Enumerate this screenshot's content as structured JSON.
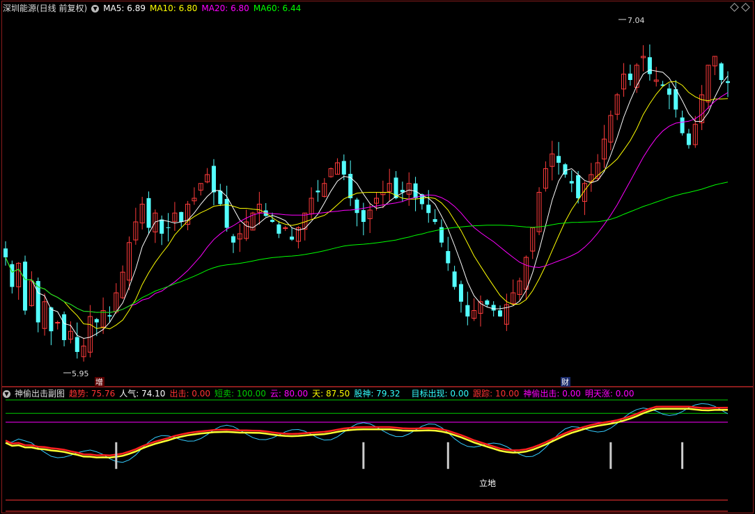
{
  "main": {
    "title": "深圳能源(日线 前复权)",
    "ma_labels": [
      {
        "text": "MA5: 6.89",
        "color": "#ffffff"
      },
      {
        "text": "MA10: 6.80",
        "color": "#ffff00"
      },
      {
        "text": "MA20: 6.80",
        "color": "#ff00ff"
      },
      {
        "text": "MA60: 6.44",
        "color": "#00ff00"
      }
    ],
    "high_label": "7.04",
    "low_label": "5.95",
    "marker_left": "增",
    "marker_right": "财"
  },
  "sub": {
    "title": "神偷出击副图",
    "values": [
      {
        "text": "趋势: 75.76",
        "color": "#ff3333"
      },
      {
        "text": "人气: 74.10",
        "color": "#ffffff"
      },
      {
        "text": "出击: 0.00",
        "color": "#ff3333"
      },
      {
        "text": "短卖: 100.00",
        "color": "#00cc00"
      },
      {
        "text": "云: 80.00",
        "color": "#ff00ff"
      },
      {
        "text": "天: 87.50",
        "color": "#ffff00"
      },
      {
        "text": "股神: 79.32",
        "color": "#33ffff"
      },
      {
        "text": "目标出现: 0.00",
        "color": "#33ffff"
      },
      {
        "text": "跟踪: 10.00",
        "color": "#ff3333"
      },
      {
        "text": "神偷出击: 0.00",
        "color": "#ff00ff"
      },
      {
        "text": "明天涨: 0.00",
        "color": "#ff00ff"
      }
    ],
    "annotation": "立地"
  },
  "chart_data": [
    {
      "type": "candlestick",
      "title": "深圳能源(日线 前复权)",
      "ylim": [
        5.9,
        7.1
      ],
      "series": [
        {
          "name": "MA5",
          "color": "#ffffff"
        },
        {
          "name": "MA10",
          "color": "#ffff00"
        },
        {
          "name": "MA20",
          "color": "#ff00ff"
        },
        {
          "name": "MA60",
          "color": "#00ff00"
        }
      ],
      "last_values": {
        "MA5": 6.89,
        "MA10": 6.8,
        "MA20": 6.8,
        "MA60": 6.44
      },
      "annotations": [
        {
          "text": "7.04",
          "kind": "high"
        },
        {
          "text": "5.95",
          "kind": "low"
        }
      ],
      "approx_closes": [
        6.3,
        6.2,
        6.28,
        6.12,
        6.22,
        6.08,
        6.15,
        6.05,
        6.08,
        6.02,
        6.05,
        5.98,
        6.0,
        6.1,
        6.08,
        6.12,
        6.1,
        6.18,
        6.25,
        6.35,
        6.42,
        6.48,
        6.4,
        6.45,
        6.38,
        6.4,
        6.45,
        6.42,
        6.48,
        6.5,
        6.55,
        6.58,
        6.52,
        6.48,
        6.4,
        6.35,
        6.38,
        6.42,
        6.45,
        6.48,
        6.44,
        6.42,
        6.38,
        6.4,
        6.36,
        6.4,
        6.45,
        6.5,
        6.52,
        6.55,
        6.6,
        6.62,
        6.58,
        6.5,
        6.45,
        6.42,
        6.46,
        6.5,
        6.52,
        6.55,
        6.5,
        6.52,
        6.55,
        6.5,
        6.48,
        6.45,
        6.42,
        6.35,
        6.28,
        6.2,
        6.15,
        6.1,
        6.12,
        6.15,
        6.14,
        6.12,
        6.1,
        6.14,
        6.18,
        6.22,
        6.3,
        6.4,
        6.52,
        6.6,
        6.65,
        6.62,
        6.58,
        6.55,
        6.5,
        6.55,
        6.58,
        6.62,
        6.7,
        6.78,
        6.85,
        6.92,
        6.9,
        6.95,
        6.98,
        6.92,
        6.9,
        6.88,
        6.85,
        6.8,
        6.72,
        6.68,
        6.75,
        6.85,
        6.95,
        6.98,
        6.9,
        6.89
      ]
    },
    {
      "type": "line",
      "title": "神偷出击副图",
      "series": [
        {
          "name": "趋势",
          "value": 75.76
        },
        {
          "name": "人气",
          "value": 74.1
        },
        {
          "name": "出击",
          "value": 0.0
        },
        {
          "name": "短卖",
          "value": 100.0
        },
        {
          "name": "云",
          "value": 80.0
        },
        {
          "name": "天",
          "value": 87.5
        },
        {
          "name": "股神",
          "value": 79.32
        },
        {
          "name": "目标出现",
          "value": 0.0
        },
        {
          "name": "跟踪",
          "value": 10.0
        },
        {
          "name": "神偷出击",
          "value": 0.0
        },
        {
          "name": "明天涨",
          "value": 0.0
        }
      ]
    }
  ]
}
